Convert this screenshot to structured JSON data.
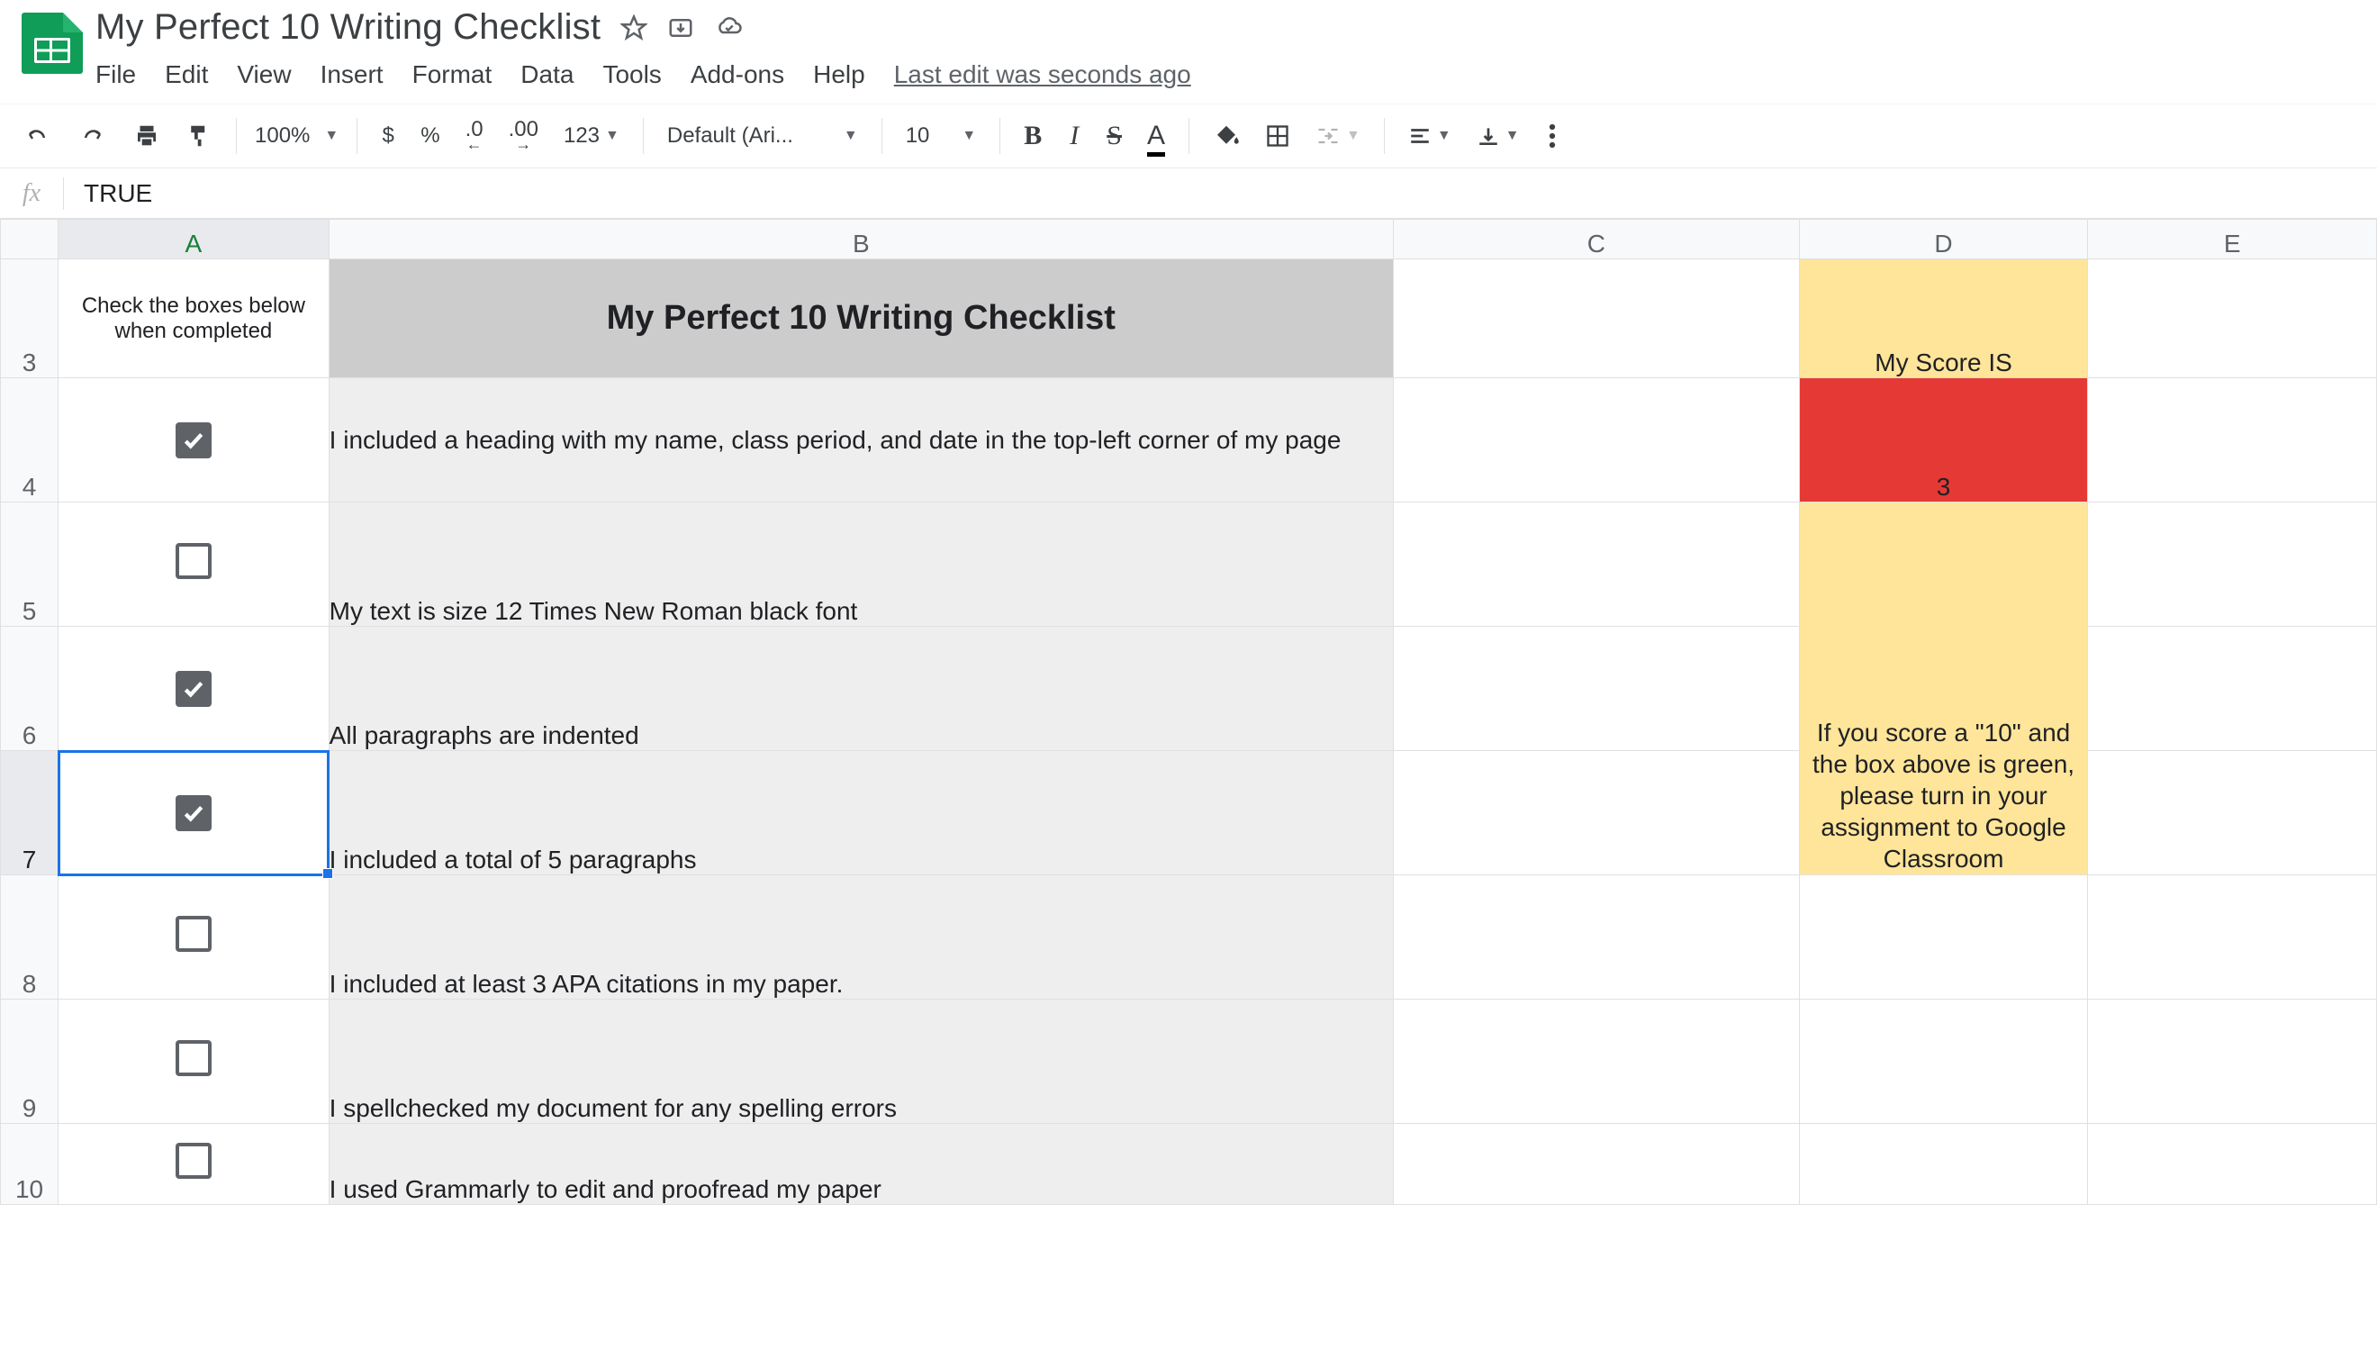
{
  "doc_title": "My Perfect 10 Writing Checklist",
  "menus": {
    "file": "File",
    "edit": "Edit",
    "view": "View",
    "insert": "Insert",
    "format": "Format",
    "data": "Data",
    "tools": "Tools",
    "addons": "Add-ons",
    "help": "Help"
  },
  "last_edit": "Last edit was seconds ago",
  "toolbar": {
    "zoom": "100%",
    "currency": "$",
    "percent": "%",
    "dec_dec": ".0",
    "inc_dec": ".00",
    "num_fmt": "123",
    "font": "Default (Ari...",
    "font_size": "10",
    "bold": "B",
    "italic": "I",
    "strike": "S",
    "textcolor": "A"
  },
  "formula": {
    "fx": "fx",
    "value": "TRUE"
  },
  "columns": {
    "A": "A",
    "B": "B",
    "C": "C",
    "D": "D",
    "E": "E"
  },
  "rows": {
    "r3": "3",
    "r4": "4",
    "r5": "5",
    "r6": "6",
    "r7": "7",
    "r8": "8",
    "r9": "9",
    "r10": "10"
  },
  "content": {
    "instr": "Check the boxes below when completed",
    "title": "My Perfect 10 Writing Checklist",
    "items": [
      {
        "checked": true,
        "text": "I included a heading with my name, class period, and date in the top-left corner of my page"
      },
      {
        "checked": false,
        "text": "My text is size 12 Times New Roman black font"
      },
      {
        "checked": true,
        "text": "All paragraphs are indented"
      },
      {
        "checked": true,
        "text": "I included a total of 5 paragraphs"
      },
      {
        "checked": false,
        "text": "I included at least 3 APA citations in my paper."
      },
      {
        "checked": false,
        "text": "I spellchecked my document for any spelling errors"
      },
      {
        "checked": false,
        "text": "I used Grammarly to edit and proofread my paper"
      }
    ],
    "score_label": "My Score IS",
    "score_value": "3",
    "score_note": "If you score a \"10\" and the box above is green, please turn in your assignment to Google Classroom"
  }
}
